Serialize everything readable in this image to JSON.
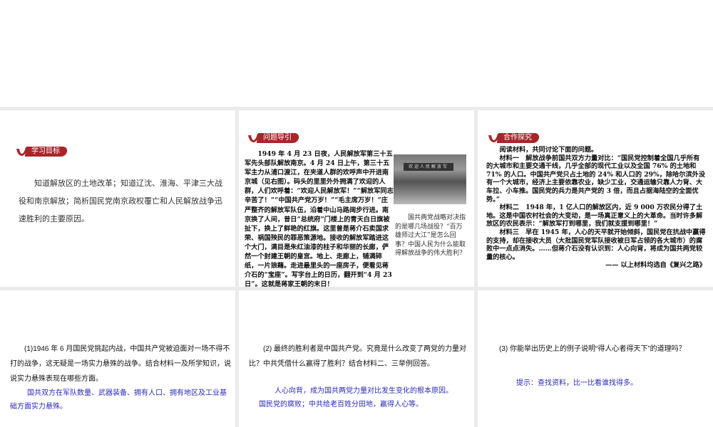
{
  "brand_color": "#a8262b",
  "panel1": {
    "badge": "学习目标",
    "text": "知道解放区的土地改革；知道辽沈、淮海、平津三大战役和南京解放；简析国民党南京政权覆亡和人民解放战争迅速胜利的主要原因。"
  },
  "panel2": {
    "badge": "问题导引",
    "text": "1949 年 4 月 23 日夜，人民解放军第三十五军先头部队解放南京。4 月 24 日上午，第三十五军主力从浦口渡江，在夹道人群的欢呼声中开进南京城（见右图）。码头的里里外外拥满了欢迎的人群，人们欢呼着：“欢迎人民解放军！”“解放军同志辛苦了！”“中国共产党万岁！”“毛主席万岁！”庄严整齐的解放军队伍，沿着中山马路阔步行进。南京换了人间，昔日“总统府”门楼上的青天白日旗被扯下，换上了鲜艳的红旗。这里曾是蒋介石卖国求荣、祸国殃民的罪恶策源地。接收的解放军踏进这个大门，满目是朱红油漆的柱子和华丽的长廊，俨然一个封建王朝的皇宫。地上、走廊上，铺满碎纸，一片狼藉。走进最里头的一座房子，便看见蒋介石的“宝座”。写字台上的日历，翻开到“4 月 23 日”。这就是蒋家王朝的末日！",
    "photo_banner": "欢迎人民解放军",
    "caption": "国共两党战略对决指的是哪几场战役？“百万雄师过大江”是怎么回事？中国人民为什么能取得解放战争的伟大胜利？"
  },
  "panel3": {
    "badge": "合作探究",
    "intro": "阅读材料，共同讨论下面的问题。",
    "m1": "材料一　解放战争前国共双方力量对比：“国民党控制着全国几乎所有的大城市和主要交通干线，几乎全部的现代工业以及全国 76% 的土地和 71% 的人口。中国共产党只占土地的 24% 和人口的 29%，除哈尔滨外没有一个大城市，经济上主要依靠农业，缺少工业，交通运输只靠人力背、大车拉、小车推。国民党的兵力是共产党的 3 倍，而且占据海陆空的全面优势。”",
    "m2": "材料二　1948 年，1 亿人口的解放区内，近 9 000 万农民分得了土地。这是中国农村社会的大变动，是一场真正意义上的大革命。当时许多解放区的农民表示：“解放军打到哪里，我们就支援到哪里！”",
    "m3": "材料三　早在 1945 年，人心的天平就开始倾斜，国民党在抗战中赢得的支持，却在接收大员（大批国民党军队接收被日军占领的各大城市）的腐败中一点点消失。……但蒋介石没有认识到：人心向背，将成为国共两党较量的核心。",
    "source": "—— 以上材料均选自《复兴之路》"
  },
  "panel4": {
    "question": "(1)1946 年 6 月国民党挑起内战，中国共产党被迫面对一场不得不打的战争，这无疑是一场实力悬殊的战争。结合材料一及所学知识，说说实力悬殊表现在哪些方面。",
    "answer": "国共双方在军队数量、武器装备、拥有人口、拥有地区及工业基础方面实力悬殊。"
  },
  "panel5": {
    "question": "(2) 最终的胜利者是中国共产党。究竟是什么改变了两党的力量对比？中共凭借什么赢得了胜利？结合材料二、三举例回答。",
    "answer1": "人心向背，成为国共两党力量对比发生变化的根本原因。",
    "answer2": "国民党的腐败；中共给老百姓分田地，赢得人心等。"
  },
  "panel6": {
    "question": "(3) 你能举出历史上的例子说明“得人心者得天下”的道理吗？",
    "answer": "提示：查找资料，比一比看谁找得多。"
  }
}
